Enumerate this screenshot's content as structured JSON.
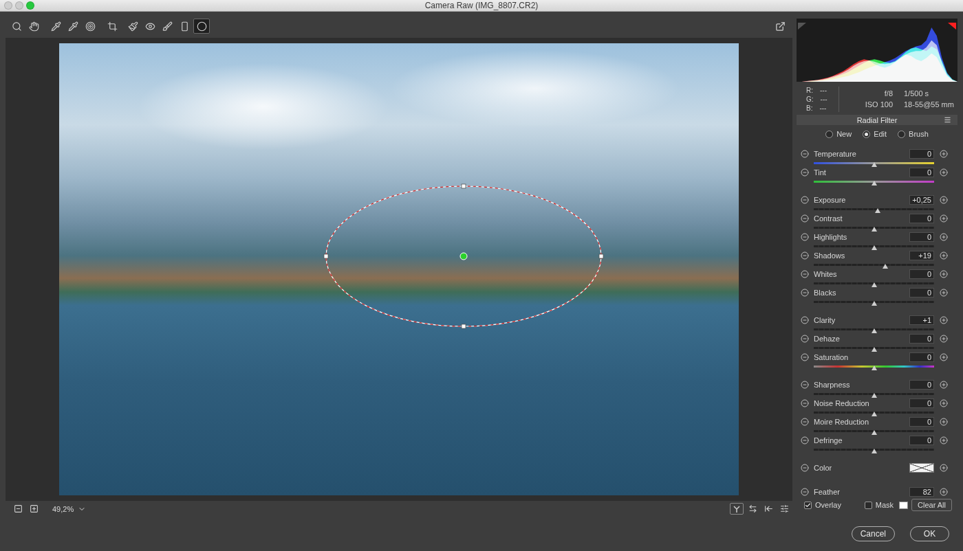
{
  "window": {
    "title": "Camera Raw (IMG_8807.CR2)",
    "controls": [
      {
        "color": "#cdcdcd"
      },
      {
        "color": "#cdcdcd"
      },
      {
        "color": "#27c93f"
      }
    ]
  },
  "toolbar": {
    "tools": [
      {
        "selected": false
      },
      {
        "selected": false
      },
      {
        "selected": false
      },
      {
        "selected": false
      },
      {
        "selected": false
      },
      {
        "selected": false
      },
      {
        "selected": false
      },
      {
        "selected": false
      },
      {
        "selected": false
      },
      {
        "selected": false
      },
      {
        "selected": true
      }
    ]
  },
  "preview": {
    "zoom": "49,2%"
  },
  "histogram": {
    "clipping": {
      "shadows": false,
      "highlights": true
    },
    "series": [
      {
        "color": "#ff2020",
        "values": [
          0,
          0,
          1,
          2,
          3,
          5,
          7,
          10,
          14,
          18,
          24,
          30,
          35,
          38,
          36,
          30,
          26,
          24,
          27,
          33,
          40,
          46,
          44,
          38,
          35,
          40,
          48,
          42,
          25,
          10,
          3,
          0
        ]
      },
      {
        "color": "#20ff40",
        "values": [
          0,
          0,
          0,
          1,
          2,
          3,
          5,
          7,
          10,
          13,
          17,
          22,
          27,
          32,
          36,
          38,
          36,
          33,
          32,
          35,
          42,
          50,
          56,
          58,
          55,
          52,
          60,
          55,
          35,
          14,
          4,
          0
        ]
      },
      {
        "color": "#2040ff",
        "values": [
          0,
          0,
          0,
          0,
          1,
          2,
          3,
          4,
          6,
          8,
          10,
          13,
          16,
          20,
          24,
          27,
          30,
          33,
          36,
          40,
          46,
          52,
          56,
          60,
          62,
          70,
          92,
          78,
          40,
          15,
          4,
          0
        ]
      },
      {
        "color": "#c8c8c8",
        "values": [
          0,
          0,
          1,
          2,
          3,
          4,
          6,
          9,
          12,
          16,
          21,
          27,
          32,
          35,
          36,
          34,
          31,
          30,
          31,
          34,
          40,
          46,
          50,
          52,
          52,
          58,
          70,
          62,
          32,
          12,
          3,
          0
        ]
      }
    ]
  },
  "info": {
    "rgb": [
      {
        "label": "R:",
        "value": "---"
      },
      {
        "label": "G:",
        "value": "---"
      },
      {
        "label": "B:",
        "value": "---"
      }
    ],
    "exif": [
      "f/8",
      "1/500 s",
      "ISO 100",
      "18-55@55 mm"
    ]
  },
  "panel": {
    "title": "Radial Filter",
    "modes": [
      {
        "label": "New",
        "selected": false
      },
      {
        "label": "Edit",
        "selected": true
      },
      {
        "label": "Brush",
        "selected": false
      }
    ],
    "groups": [
      {
        "items": [
          {
            "kind": "temperature",
            "label": "Temperature",
            "value": "0",
            "level": 0.5
          },
          {
            "kind": "tint",
            "label": "Tint",
            "value": "0",
            "level": 0.5
          }
        ]
      },
      {
        "items": [
          {
            "kind": "slider",
            "label": "Exposure",
            "value": "+0,25",
            "level": 0.531
          },
          {
            "kind": "slider",
            "label": "Contrast",
            "value": "0",
            "level": 0.5
          },
          {
            "kind": "slider",
            "label": "Highlights",
            "value": "0",
            "level": 0.5
          },
          {
            "kind": "slider",
            "label": "Shadows",
            "value": "+19",
            "level": 0.595
          },
          {
            "kind": "slider",
            "label": "Whites",
            "value": "0",
            "level": 0.5
          },
          {
            "kind": "slider",
            "label": "Blacks",
            "value": "0",
            "level": 0.5
          }
        ]
      },
      {
        "items": [
          {
            "kind": "slider",
            "label": "Clarity",
            "value": "+1",
            "level": 0.505
          },
          {
            "kind": "slider",
            "label": "Dehaze",
            "value": "0",
            "level": 0.5
          },
          {
            "kind": "saturation",
            "label": "Saturation",
            "value": "0",
            "level": 0.5
          }
        ]
      },
      {
        "items": [
          {
            "kind": "slider",
            "label": "Sharpness",
            "value": "0",
            "level": 0.5
          },
          {
            "kind": "slider",
            "label": "Noise Reduction",
            "value": "0",
            "level": 0.5
          },
          {
            "kind": "slider",
            "label": "Moire Reduction",
            "value": "0",
            "level": 0.5
          },
          {
            "kind": "slider",
            "label": "Defringe",
            "value": "0",
            "level": 0.5
          }
        ]
      },
      {
        "items": [
          {
            "kind": "swatch",
            "label": "Color"
          }
        ]
      },
      {
        "items": [
          {
            "kind": "slider",
            "label": "Feather",
            "value": "82",
            "level": 0.82
          }
        ]
      }
    ],
    "overlay": {
      "label": "Overlay",
      "checked": true
    },
    "mask": {
      "label": "Mask",
      "checked": false
    },
    "clear": "Clear All"
  },
  "buttons": [
    {
      "label": "Cancel"
    },
    {
      "label": "OK"
    }
  ]
}
